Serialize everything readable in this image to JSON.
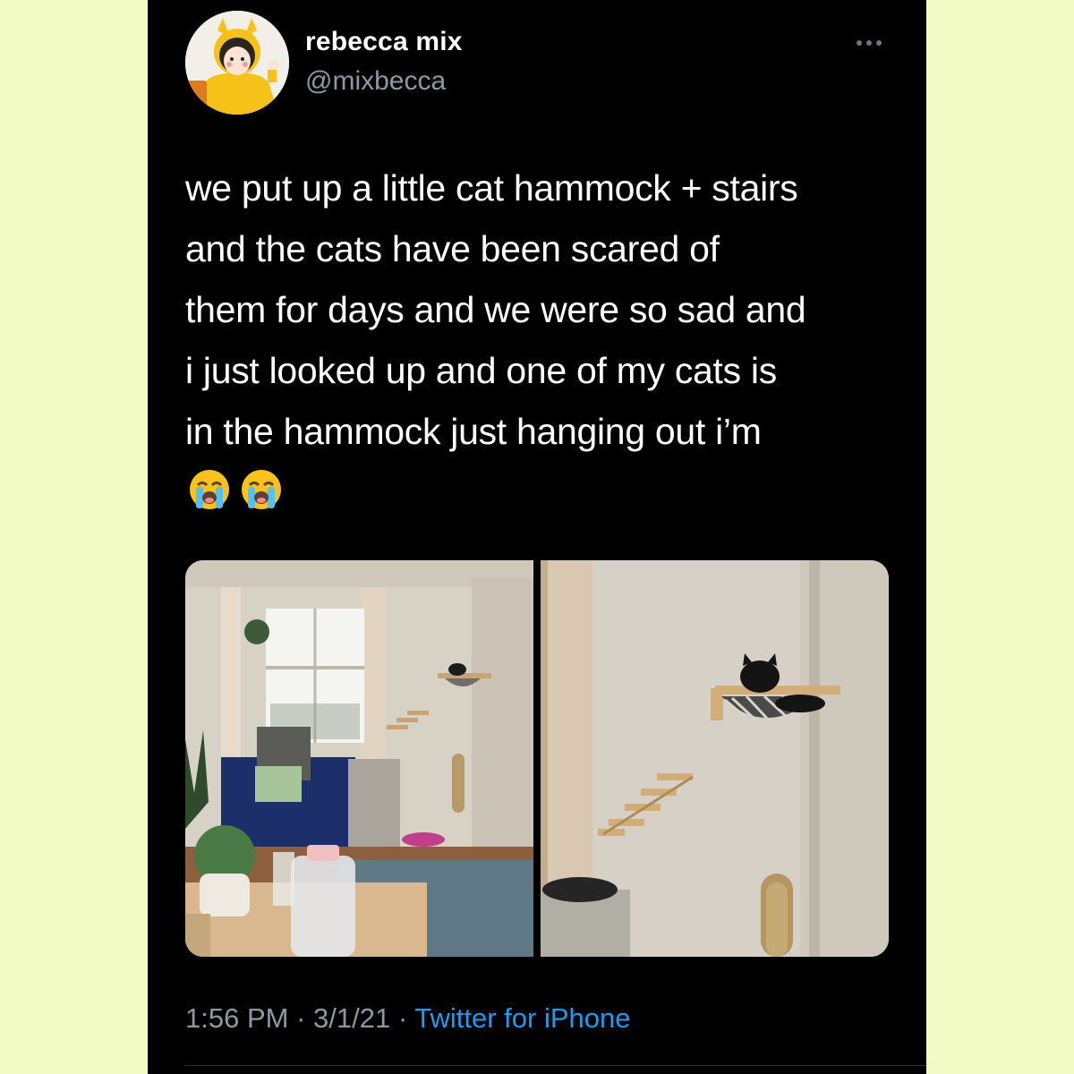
{
  "user": {
    "display_name": "rebecca mix",
    "handle": "@mixbecca",
    "avatar_icon": "avatar-illustration"
  },
  "more_button_icon": "more-dots-icon",
  "tweet": {
    "lines": [
      "we put up a little cat hammock + stairs",
      "and the cats have been scared of",
      "them for days and we were so sad and",
      "i just looked up and one of my cats is",
      "in the hammock just hanging out i’m"
    ],
    "emojis": [
      "loudly-crying-face",
      "loudly-crying-face"
    ]
  },
  "media": {
    "photos": [
      "living-room-photo",
      "cat-hammock-photo"
    ]
  },
  "meta": {
    "time": "1:56 PM",
    "separator": "·",
    "date": "3/1/21",
    "source": "Twitter for iPhone"
  },
  "colors": {
    "page_background": "#f4fcc6",
    "tweet_background": "#000000",
    "text": "#ffffff",
    "secondary_text": "#8b98a5",
    "link": "#1d9bf0"
  }
}
